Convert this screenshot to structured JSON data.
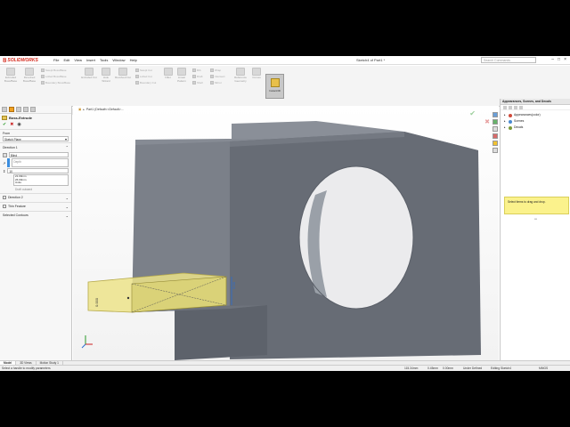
{
  "app": {
    "brand": "SOLIDWORKS",
    "doc_title": "Sketch4 of Part1 *",
    "search_placeholder": "Search Commands",
    "menus": [
      "File",
      "Edit",
      "View",
      "Insert",
      "Tools",
      "Window",
      "Help"
    ]
  },
  "commands": {
    "large": [
      {
        "label": "Extruded Boss/Base"
      },
      {
        "label": "Revolved Boss/Base"
      },
      {
        "label": "Extruded Cut"
      },
      {
        "label": "Hole Wizard"
      },
      {
        "label": "Revolved Cut"
      },
      {
        "label": "Fillet"
      },
      {
        "label": "Linear Pattern"
      },
      {
        "label": "Reference Geometry"
      },
      {
        "label": "Curves"
      }
    ],
    "small": [
      "Swept Boss/Base",
      "Lofted Boss/Base",
      "Boundary Boss/Base",
      "Swept Cut",
      "Lofted Cut",
      "Boundary Cut",
      "Rib",
      "Draft",
      "Shell",
      "Wrap",
      "Intersect",
      "Mirror"
    ],
    "instant3d": "Instant3D"
  },
  "tabs": [
    "Features",
    "Sketch",
    "Surfaces",
    "Sheet Metal",
    "Evaluate",
    "DimXpert",
    "SOLIDWORKS Add-Ins",
    "SOLIDWORKS MBD",
    "SOLIDWORKS CAM"
  ],
  "property_manager": {
    "title": "Boss-Extrude",
    "from_label": "From",
    "from_value": "Sketch Plane",
    "direction1_label": "Direction 1",
    "end_condition": "Blind",
    "depth_placeholder": "Depth",
    "depth_value": "10",
    "depth_history": [
      "21.00mm",
      "26.00mm",
      "Units"
    ],
    "draft_outward": "Draft outward",
    "direction2_label": "Direction 2",
    "thin_feature_label": "Thin Feature",
    "selected_contours_label": "Selected Contours"
  },
  "viewport": {
    "breadcrumb": "Part1 (Default<<Default>...",
    "dim_vertical": "6.00",
    "dim_left": "0.000"
  },
  "task_pane": {
    "title": "Appearances, Scenes, and Decals",
    "items": [
      {
        "label": "Appearances(color)",
        "color": "#d04a3a"
      },
      {
        "label": "Scenes",
        "color": "#4a8ad0"
      },
      {
        "label": "Decals",
        "color": "#7a9a3a"
      }
    ],
    "hint": "Select items to drag and drop."
  },
  "bottom_tabs": [
    "Model",
    "3D Views",
    "Motion Study 1"
  ],
  "status": {
    "message": "Select a handle to modify parameters",
    "coords": [
      "115.34mm",
      "0.45mm",
      "0.00mm"
    ],
    "state": "Under Defined",
    "mode": "Editing Sketch4",
    "units": "MMGS"
  },
  "colors": {
    "accent": "#d52b1e",
    "body_face": "#6f747d",
    "body_top": "#8a8f98",
    "preview": "#ece38a"
  }
}
